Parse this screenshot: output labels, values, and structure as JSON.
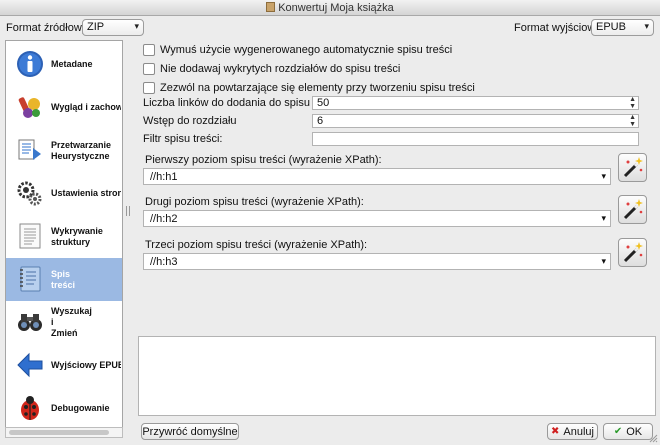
{
  "window": {
    "title": "Konwertuj Moja książka"
  },
  "topbar": {
    "input_format_label": "Format źródłowy:",
    "input_format_value": "ZIP",
    "output_format_label": "Format wyjściowy",
    "output_format_value": "EPUB"
  },
  "sidebar": {
    "items": [
      {
        "label": "Metadane",
        "icon": "info-icon",
        "active": false
      },
      {
        "label": "Wygląd i zachowa",
        "icon": "paint-icon",
        "active": false
      },
      {
        "label": "Przetwarzanie\nHeurystyczne",
        "icon": "heuristics-icon",
        "active": false
      },
      {
        "label": "Ustawienia strony",
        "icon": "gears-icon",
        "active": false
      },
      {
        "label": "Wykrywanie\nstruktury",
        "icon": "document-icon",
        "active": false
      },
      {
        "label": "Spis\ntreści",
        "icon": "toc-icon",
        "active": true
      },
      {
        "label": "Wyszukaj\ni\nZmień",
        "icon": "binoculars-icon",
        "active": false
      },
      {
        "label": "Wyjściowy EPUB",
        "icon": "arrow-left-icon",
        "active": false
      },
      {
        "label": "Debugowanie",
        "icon": "ladybug-icon",
        "active": false
      }
    ]
  },
  "toc": {
    "force_label": "Wymuś użycie wygenerowanego automatycznie spisu treści",
    "no_chapters_label": "Nie dodawaj wykrytych rozdziałów do spisu treści",
    "allow_duplicates_label": "Zezwól na powtarzające się elementy przy tworzeniu spisu treści",
    "links_count_label": "Liczba linków do dodania do spisu treści",
    "links_count_value": "50",
    "chapter_threshold_label": "Wstęp do rozdziału",
    "chapter_threshold_value": "6",
    "filter_label": "Filtr spisu treści:",
    "filter_value": "",
    "level1_label": "Pierwszy poziom spisu treści (wyrażenie XPath):",
    "level1_value": "//h:h1",
    "level2_label": "Drugi poziom spisu treści (wyrażenie XPath):",
    "level2_value": "//h:h2",
    "level3_label": "Trzeci poziom spisu treści (wyrażenie XPath):",
    "level3_value": "//h:h3"
  },
  "buttons": {
    "restore_defaults": "Przywróć domyślne",
    "cancel": "Anuluj",
    "ok": "OK"
  }
}
